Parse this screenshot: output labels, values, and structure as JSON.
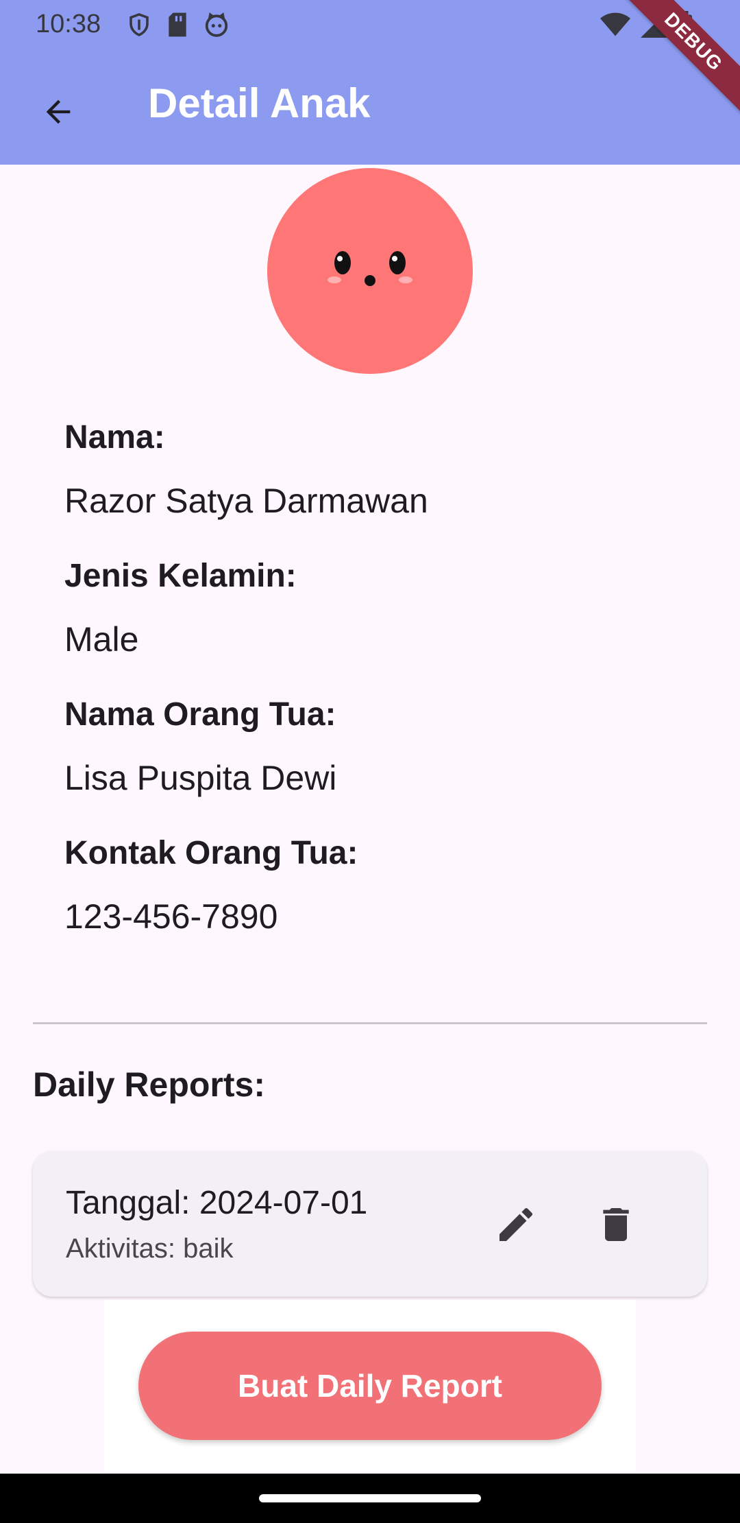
{
  "status_bar": {
    "time": "10:38",
    "left_icons": [
      "shield-icon",
      "sd-card-icon",
      "cat-face-icon"
    ],
    "right_icons": [
      "wifi-icon",
      "cellular-signal-icon",
      "battery-icon"
    ]
  },
  "app_bar": {
    "title": "Detail Anak",
    "back_icon": "arrow-back-icon",
    "color": "#8c9bf0"
  },
  "debug_banner": "DEBUG",
  "avatar": {
    "icon": "cute-face-avatar",
    "color": "#ff7676"
  },
  "details": {
    "name_label": "Nama:",
    "name_value": "Razor Satya Darmawan",
    "gender_label": "Jenis Kelamin:",
    "gender_value": "Male",
    "parent_name_label": "Nama Orang Tua:",
    "parent_name_value": "Lisa Puspita Dewi",
    "parent_contact_label": "Kontak Orang Tua:",
    "parent_contact_value": "123-456-7890"
  },
  "reports": {
    "section_title": "Daily Reports:",
    "items": [
      {
        "date": "Tanggal: 2024-07-01",
        "activity": "Aktivitas: baik",
        "edit_icon": "pencil-edit-icon",
        "delete_icon": "trash-delete-icon"
      }
    ]
  },
  "actions": {
    "create_report_label": "Buat Daily Report",
    "button_color": "#f27176"
  }
}
